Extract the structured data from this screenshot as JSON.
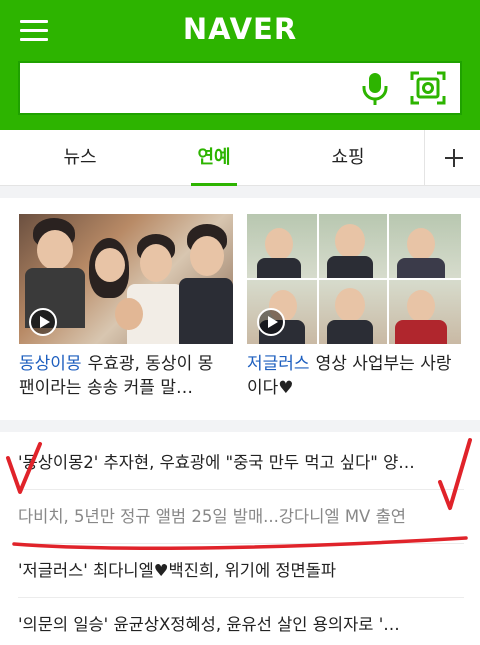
{
  "header": {
    "logo": "NAVER",
    "search": {
      "value": "",
      "placeholder": ""
    },
    "icons": {
      "menu": "hamburger-icon",
      "voice": "microphone-icon",
      "lens": "camera-lens-icon"
    },
    "brand_color": "#2db400"
  },
  "tabs": [
    {
      "label": "뉴스",
      "active": false
    },
    {
      "label": "연예",
      "active": true
    },
    {
      "label": "쇼핑",
      "active": false
    }
  ],
  "video_cards": [
    {
      "tag": "동상이몽",
      "title": "우효광, 동상이 몽 팬이라는 송송 커플 말…"
    },
    {
      "tag": "저글러스",
      "title": "영상 사업부는 사랑이다♥"
    }
  ],
  "news": [
    {
      "title": "'동상이몽2' 추자현, 우효광에 \"중국 만두 먹고 싶다\" 양…"
    },
    {
      "title": "다비치, 5년만 정규 앨범 25일 발매...강다니엘 MV 출연"
    },
    {
      "title": "'저글러스' 최다니엘♥백진희, 위기에 정면돌파"
    },
    {
      "title": "'의문의 일승' 윤균상X정혜성, 윤유선 살인 용의자로 '…"
    }
  ],
  "colors": {
    "tag_blue": "#1e5fbf",
    "annotation_red": "#e0232a"
  }
}
